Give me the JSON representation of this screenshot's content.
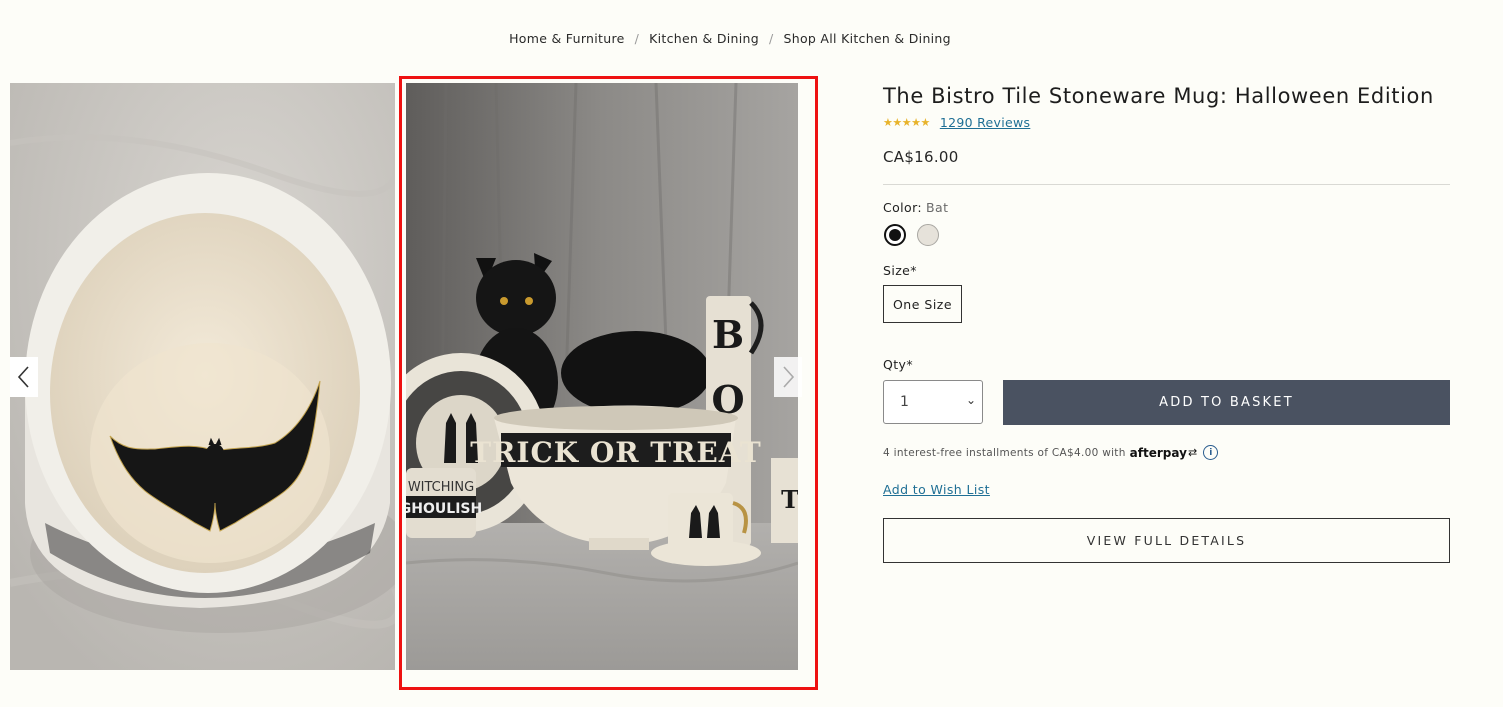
{
  "breadcrumb": {
    "items": [
      "Home & Furniture",
      "Kitchen & Dining",
      "Shop All Kitchen & Dining"
    ],
    "separator": "/"
  },
  "gallery": {
    "prev_icon": "chevron-left-icon",
    "next_icon": "chevron-right-icon",
    "images": [
      {
        "name": "mug-interior-bat-image"
      },
      {
        "name": "halloween-tableware-cat-image",
        "text": [
          "TRICK OR TREAT",
          "WITCHING",
          "GHOULISH",
          "B",
          "O",
          "T"
        ]
      }
    ],
    "highlight_color": "#ee1111"
  },
  "product": {
    "title": "The Bistro Tile Stoneware Mug: Halloween Edition",
    "stars": "★★★★★",
    "reviews": "1290 Reviews",
    "price": "CA$16.00",
    "color": {
      "label": "Color:",
      "value": "Bat",
      "swatches": [
        "Bat",
        "Cream"
      ]
    },
    "size": {
      "label": "Size*",
      "option": "One Size"
    },
    "qty": {
      "label": "Qty*",
      "value": "1",
      "chevron": "⌄"
    },
    "add_to_basket": "ADD TO BASKET",
    "afterpay": {
      "text": "4 interest-free installments of CA$4.00 with",
      "brand": "afterpay",
      "info": "i"
    },
    "wishlist": "Add to Wish List",
    "view_details": "VIEW FULL DETAILS"
  },
  "colors": {
    "accent_button": "#4a5261",
    "link": "#1f6f95",
    "star": "#e8b32b"
  }
}
